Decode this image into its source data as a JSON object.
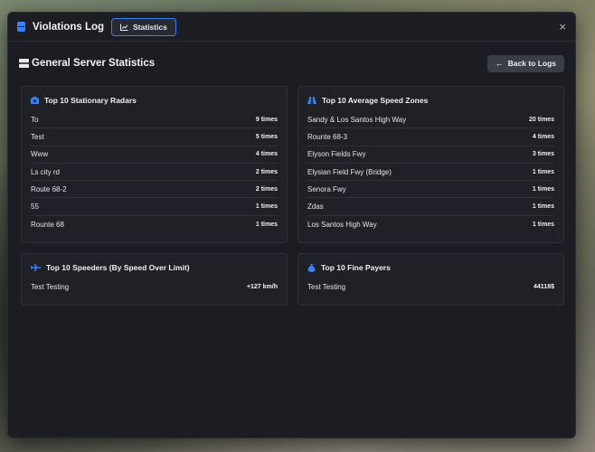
{
  "window": {
    "title": "Violations Log",
    "tab_statistics": "Statistics",
    "close_symbol": "×"
  },
  "header": {
    "title": "General Server Statistics",
    "back_label": "Back to Logs"
  },
  "colors": {
    "accent": "#3b82f6",
    "panel": "#1b1d22"
  },
  "radars": {
    "title": "Top 10 Stationary Radars",
    "icon": "camera-icon",
    "rows": [
      {
        "name": "To",
        "value": "9 times"
      },
      {
        "name": "Test",
        "value": "5 times"
      },
      {
        "name": "Www",
        "value": "4 times"
      },
      {
        "name": "Ls city rd",
        "value": "2 times"
      },
      {
        "name": "Route 68-2",
        "value": "2 times"
      },
      {
        "name": "55",
        "value": "1 times"
      },
      {
        "name": "Rounte 68",
        "value": "1 times"
      }
    ]
  },
  "zones": {
    "title": "Top 10 Average Speed Zones",
    "icon": "road-icon",
    "rows": [
      {
        "name": "Sandy & Los Santos High Way",
        "value": "20 times"
      },
      {
        "name": "Rounte 68-3",
        "value": "4 times"
      },
      {
        "name": "Elyson Fields Fwy",
        "value": "3 times"
      },
      {
        "name": "Elysian Field Fwy (Bridge)",
        "value": "1 times"
      },
      {
        "name": "Senora Fwy",
        "value": "1 times"
      },
      {
        "name": "Zdas",
        "value": "1 times"
      },
      {
        "name": "Los Santos High Way",
        "value": "1 times"
      }
    ]
  },
  "speeders": {
    "title": "Top 10 Speeders (By Speed Over Limit)",
    "icon": "plane-icon",
    "rows": [
      {
        "name": "Test Testing",
        "value": "+127 km/h"
      }
    ]
  },
  "fines": {
    "title": "Top 10 Fine Payers",
    "icon": "money-bag-icon",
    "rows": [
      {
        "name": "Test Testing",
        "value": "44118$"
      }
    ]
  }
}
